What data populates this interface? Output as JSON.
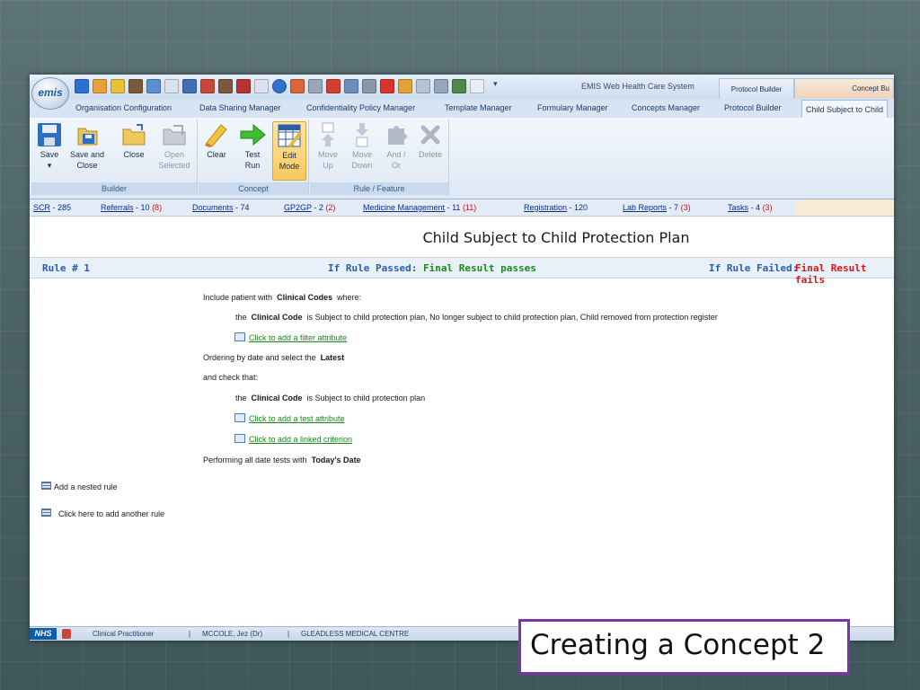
{
  "window": {
    "logo_text": "emis",
    "app_title": "EMIS Web Health Care System",
    "context_tabs": [
      "Protocol Builder",
      "Concept Bu"
    ]
  },
  "ribbon_tabs": [
    "Organisation Configuration",
    "Data Sharing Manager",
    "Confidentiality Policy Manager",
    "Template Manager",
    "Formulary Manager",
    "Concepts Manager",
    "Protocol Builder",
    "Child Subject to Child"
  ],
  "ribbon": {
    "groups": [
      "Builder",
      "Concept",
      "Rule / Feature"
    ],
    "buttons": {
      "save": "Save",
      "save_close_1": "Save and",
      "save_close_2": "Close",
      "close": "Close",
      "open_1": "Open",
      "open_2": "Selected",
      "clear": "Clear",
      "test_1": "Test",
      "test_2": "Run",
      "edit_1": "Edit",
      "edit_2": "Mode",
      "moveup_1": "Move",
      "moveup_2": "Up",
      "movedown_1": "Move",
      "movedown_2": "Down",
      "andor_1": "And /",
      "andor_2": "Or",
      "delete": "Delete"
    }
  },
  "status_links": [
    {
      "name": "SCR",
      "count": "- 285",
      "hi": ""
    },
    {
      "name": "Referrals",
      "count": "- 10",
      "hi": "(8)"
    },
    {
      "name": "Documents",
      "count": "- 74",
      "hi": ""
    },
    {
      "name": "GP2GP",
      "count": "- 2",
      "hi": "(2)"
    },
    {
      "name": "Medicine Management",
      "count": "- 11",
      "hi": "(11)"
    },
    {
      "name": "Registration",
      "count": "- 120",
      "hi": ""
    },
    {
      "name": "Lab Reports",
      "count": "- 7",
      "hi": "(3)"
    },
    {
      "name": "Tasks",
      "count": "- 4",
      "hi": "(3)"
    }
  ],
  "content": {
    "title": "Child Subject to Child Protection Plan",
    "rule": {
      "number": "Rule # 1",
      "passed_label": "If Rule Passed:",
      "passed_value": "Final Result passes",
      "failed_label": "If Rule Failed:",
      "failed_value": "Final Result fails"
    },
    "lines": {
      "include_pre": "Include patient with",
      "include_bold": "Clinical Codes",
      "include_post": "where:",
      "code1_pre": "the",
      "code1_bold": "Clinical Code",
      "code1_post": "is  Subject to child protection plan, No longer subject to child protection plan, Child removed from protection register",
      "filter_link": "Click to add a filter attribute",
      "order_pre": "Ordering by date and select the",
      "order_bold": "Latest",
      "check": "and check that:",
      "code2_pre": "the",
      "code2_bold": "Clinical Code",
      "code2_post": "is  Subject to child protection plan",
      "test_link": "Click to add a test attribute",
      "linked_link": "Click to add a linked criterion",
      "perform_pre": "Performing all date tests with",
      "perform_bold": "Today's Date"
    },
    "nested_rule": "Add a nested rule",
    "another_rule": "Click here to add another rule"
  },
  "bottom_bar": {
    "nhs": "NHS",
    "role": "Clinical Practitioner",
    "sep1": "|",
    "user": "MCCOLE, Jez (Dr)",
    "sep2": "|",
    "org": "GLEADLESS MEDICAL CENTRE"
  },
  "caption": "Creating a Concept 2"
}
